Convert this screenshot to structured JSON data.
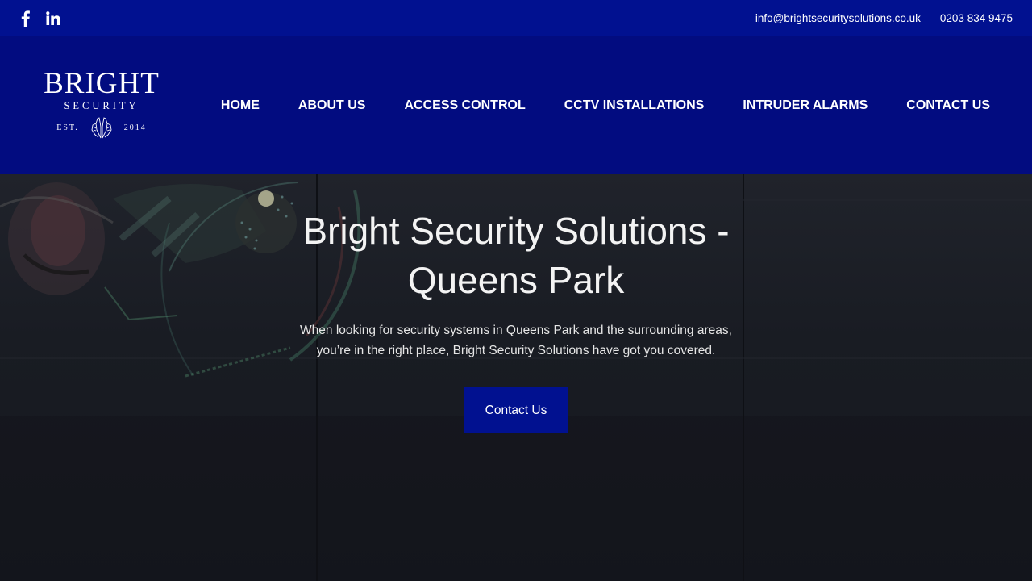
{
  "topbar": {
    "social": [
      {
        "icon": "facebook-icon"
      },
      {
        "icon": "linkedin-icon"
      }
    ],
    "email": "info@brightsecuritysolutions.co.uk",
    "phone": "0203 834 9475"
  },
  "logo": {
    "word": "BRIGHT",
    "sub": "SECURITY",
    "est_left": "EST.",
    "est_right": "2014",
    "icon": "praying-hands-icon"
  },
  "nav": {
    "items": [
      {
        "label": "HOME"
      },
      {
        "label": "ABOUT US"
      },
      {
        "label": "ACCESS CONTROL"
      },
      {
        "label": "CCTV INSTALLATIONS"
      },
      {
        "label": "INTRUDER ALARMS"
      },
      {
        "label": "CONTACT US"
      }
    ]
  },
  "hero": {
    "title_line1": "Bright Security Solutions -",
    "title_line2": "Queens Park",
    "text_line1": "When looking for security systems in Queens Park and the surrounding areas,",
    "text_line2": "you’re in the right place, Bright Security Solutions have got you covered.",
    "button_label": "Contact Us"
  },
  "colors": {
    "topbar": "#011190",
    "header": "#020c80",
    "button": "#011190",
    "hero_bg": "#191c23"
  }
}
